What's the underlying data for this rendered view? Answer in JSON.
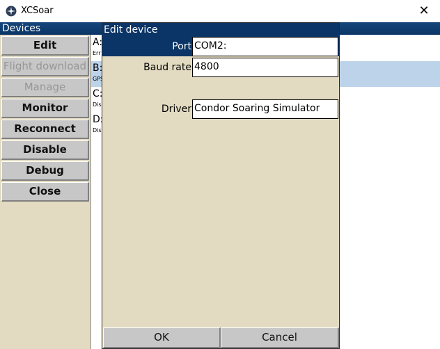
{
  "window": {
    "title": "XCSoar",
    "close_glyph": "✕"
  },
  "devices_dialog": {
    "header": "Devices",
    "buttons": [
      {
        "label": "Edit",
        "enabled": true
      },
      {
        "label": "Flight download",
        "enabled": false
      },
      {
        "label": "Manage",
        "enabled": false
      },
      {
        "label": "Monitor",
        "enabled": true
      },
      {
        "label": "Reconnect",
        "enabled": true
      },
      {
        "label": "Disable",
        "enabled": true
      },
      {
        "label": "Debug",
        "enabled": true
      },
      {
        "label": "Close",
        "enabled": true
      }
    ],
    "list": [
      {
        "label": "A:",
        "sub": "Err"
      },
      {
        "label": "B:",
        "sub": "GPS"
      },
      {
        "label": "C:",
        "sub": "Dis"
      },
      {
        "label": "D:",
        "sub": "Dis"
      }
    ]
  },
  "edit_dialog": {
    "title": "Edit device",
    "port_label": "Port",
    "port_value": "COM2:",
    "baud_label": "Baud rate",
    "baud_value": "4800",
    "driver_label": "Driver",
    "driver_value": "Condor Soaring Simulator",
    "ok_label": "OK",
    "cancel_label": "Cancel"
  },
  "colors": {
    "header_blue": "#0b3566",
    "panel_beige": "#e2dbc1",
    "selection_blue": "#bcd3ea"
  }
}
